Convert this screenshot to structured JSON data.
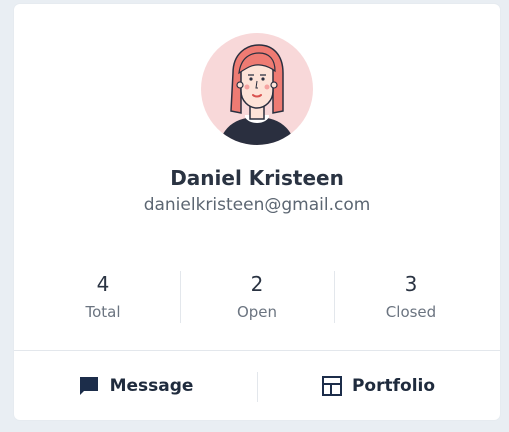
{
  "profile": {
    "name": "Daniel Kristeen",
    "email": "danielkristeen@gmail.com",
    "avatar_icon": "avatar-illustration"
  },
  "stats": [
    {
      "value": "4",
      "label": "Total"
    },
    {
      "value": "2",
      "label": "Open"
    },
    {
      "value": "3",
      "label": "Closed"
    }
  ],
  "actions": {
    "message_label": "Message",
    "message_icon": "message-icon",
    "portfolio_label": "Portfolio",
    "portfolio_icon": "portfolio-icon"
  },
  "colors": {
    "avatar_bg": "#f8d8d9",
    "hair": "#ee7b73",
    "icon_dark": "#1c2d4a"
  }
}
